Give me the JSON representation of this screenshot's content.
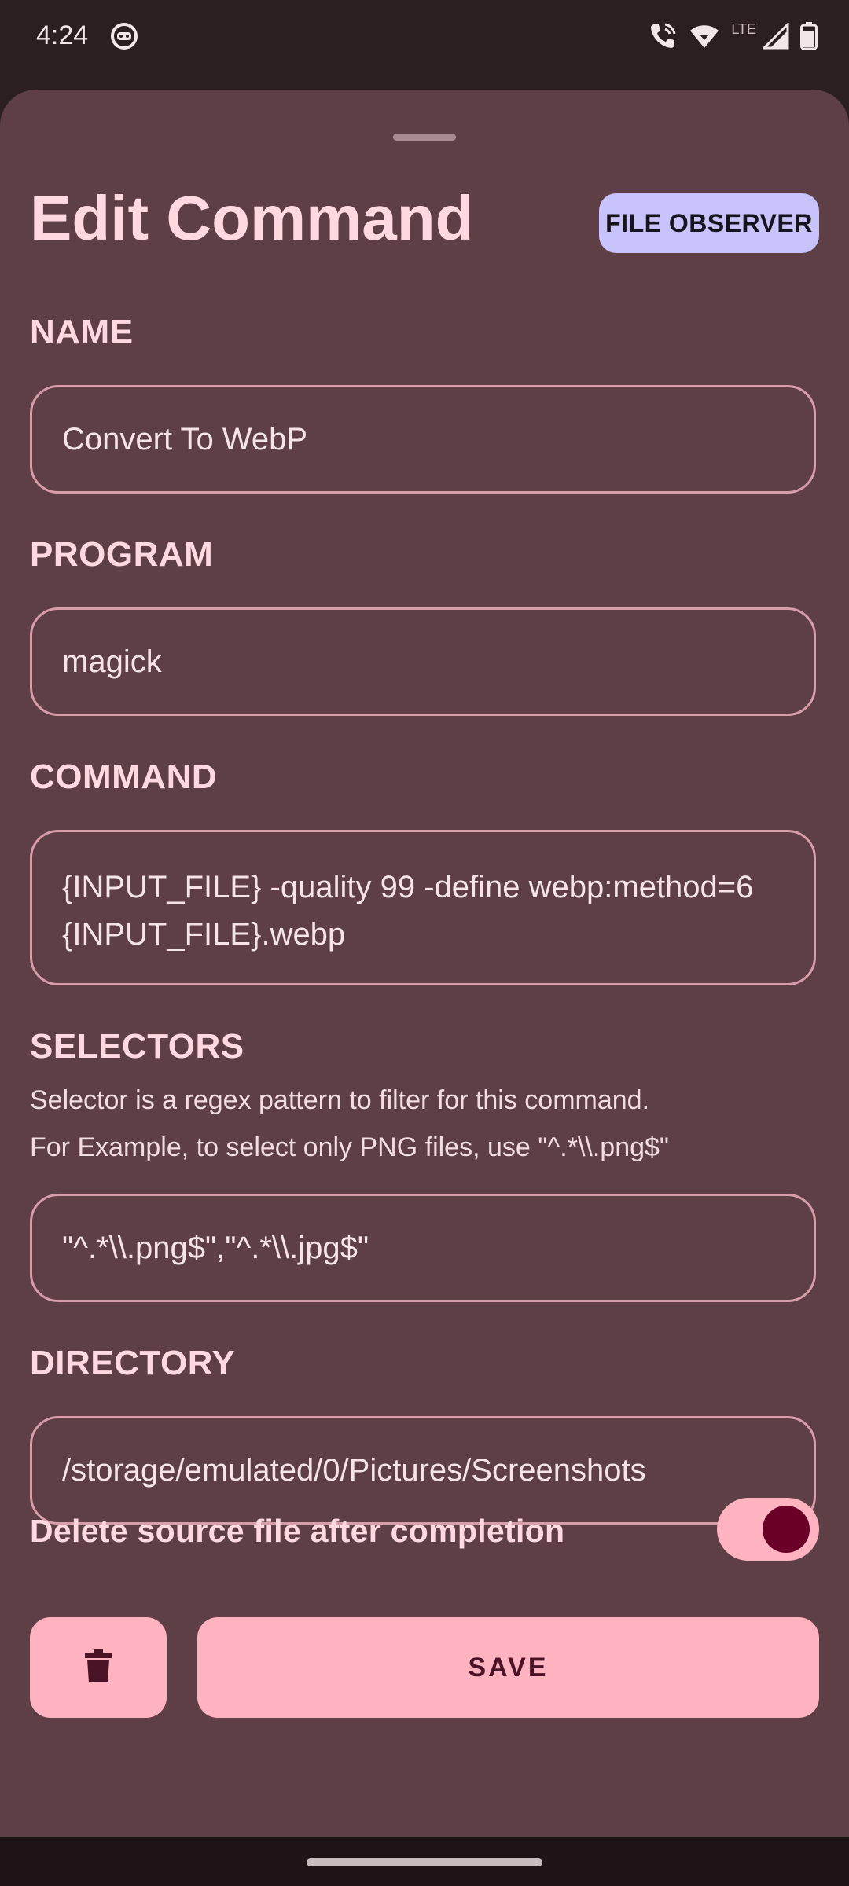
{
  "status_bar": {
    "time": "4:24",
    "network_type": "LTE",
    "icons": [
      "app-notification-icon",
      "wifi-calling-icon",
      "wifi-icon",
      "cellular-signal-icon",
      "battery-icon"
    ]
  },
  "sheet": {
    "title": "Edit Command",
    "type_chip": "FILE OBSERVER",
    "name": {
      "label": "NAME",
      "value": "Convert To WebP"
    },
    "program": {
      "label": "PROGRAM",
      "value": "magick"
    },
    "command": {
      "label": "COMMAND",
      "value": "{INPUT_FILE} -quality 99 -define webp:method=6 {INPUT_FILE}.webp"
    },
    "selectors": {
      "label": "SELECTORS",
      "helper_line1": "Selector is a regex pattern to filter for this command.",
      "helper_line2": "For Example, to select only PNG files, use \"^.*\\\\.png$\"",
      "value": "\"^.*\\\\.png$\",\"^.*\\\\.jpg$\""
    },
    "directory": {
      "label": "DIRECTORY",
      "value": "/storage/emulated/0/Pictures/Screenshots"
    },
    "delete_source": {
      "label": "Delete source file after completion",
      "enabled": true
    },
    "save_label": "SAVE"
  },
  "colors": {
    "sheet_bg": "#5e3f46",
    "accent": "#ffb3c0",
    "chip_bg": "#c9c3fb",
    "title_text": "#ffd9df"
  }
}
